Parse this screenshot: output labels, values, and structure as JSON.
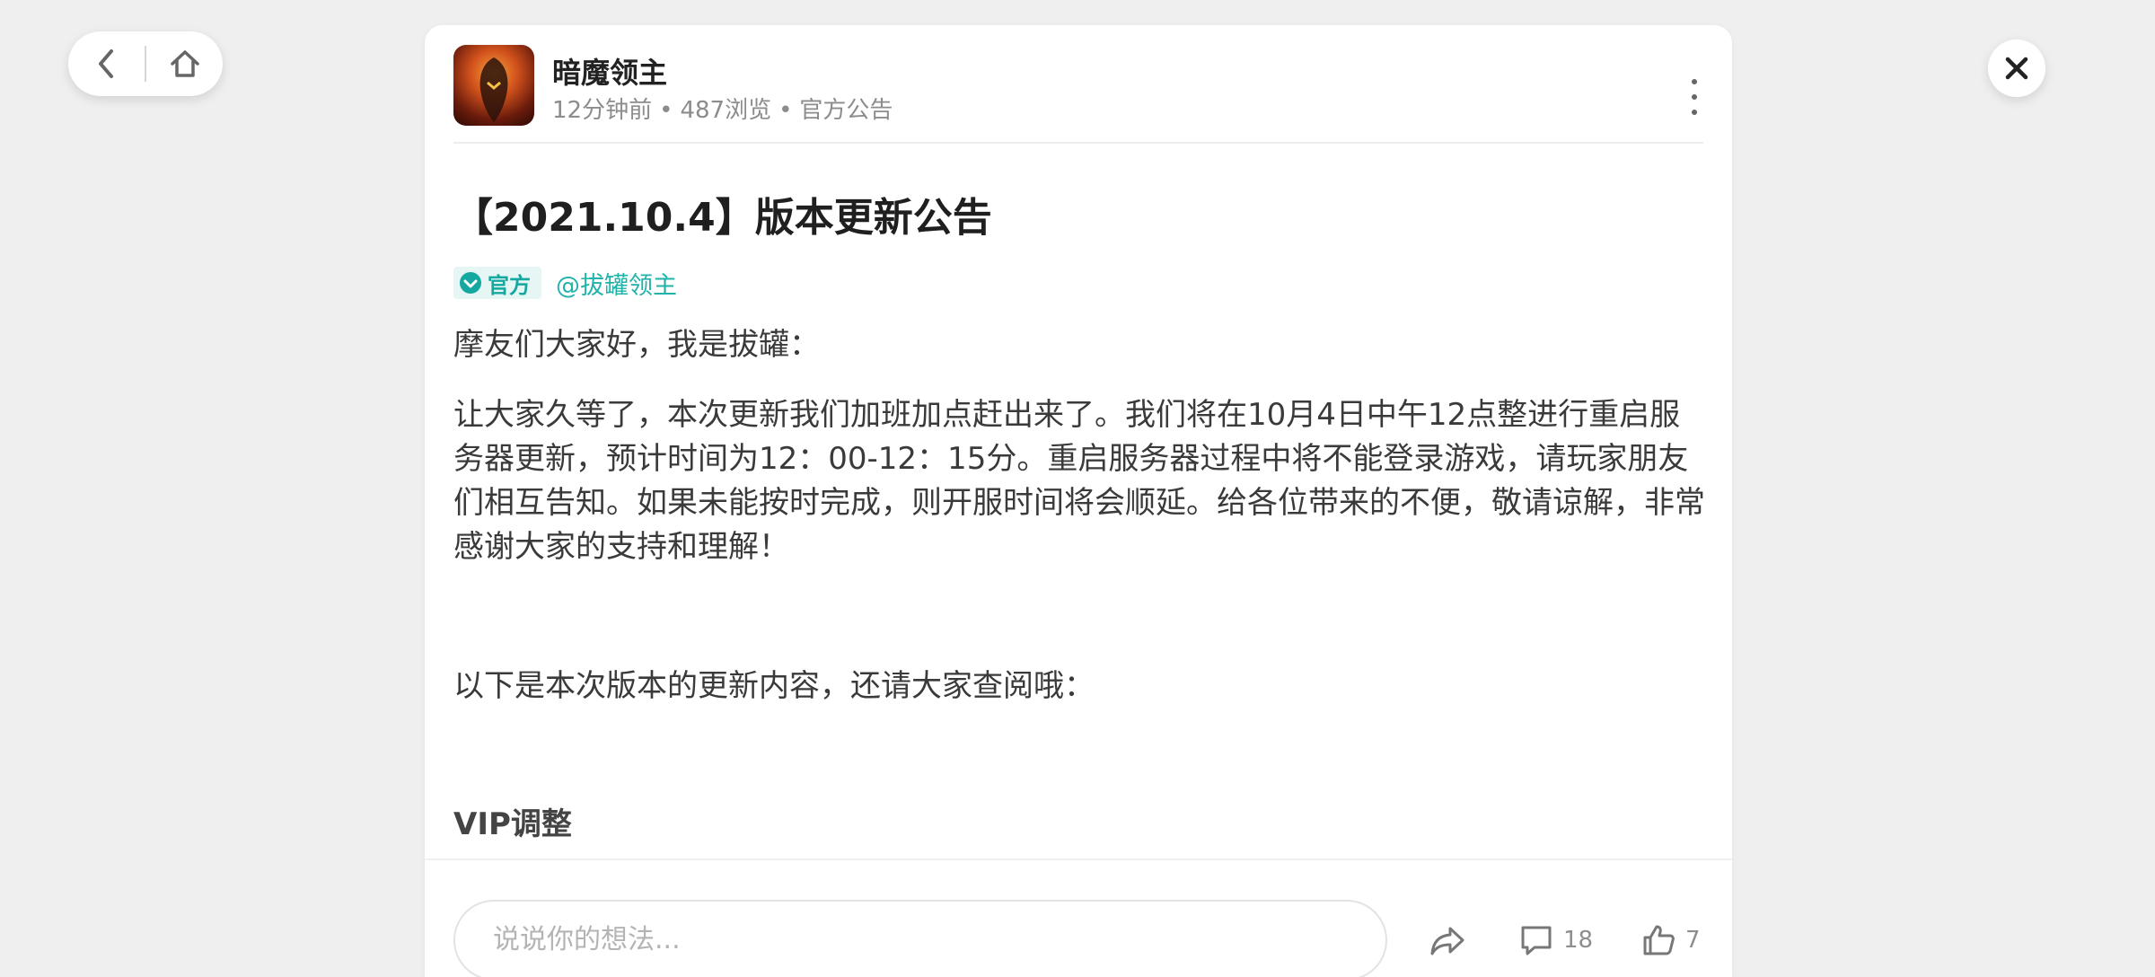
{
  "post": {
    "author": "暗魔领主",
    "meta_time": "12分钟前",
    "meta_views": "487浏览",
    "meta_category": "官方公告",
    "title": "【2021.10.4】版本更新公告",
    "official_tag": "官方",
    "mention": "@拔罐领主",
    "greeting": "摩友们大家好，我是拔罐：",
    "body": "让大家久等了，本次更新我们加班加点赶出来了。我们将在10月4日中午12点整进行重启服务器更新，预计时间为12：00-12：15分。重启服务器过程中将不能登录游戏，请玩家朋友们相互告知。如果未能按时完成，则开服时间将会顺延。给各位带来的不便，敬请谅解，非常感谢大家的支持和理解！",
    "intro": "以下是本次版本的更新内容，还请大家查阅哦：",
    "section_heading": "VIP调整"
  },
  "bottom": {
    "comment_placeholder": "说说你的想法...",
    "comment_count": "18",
    "like_count": "7"
  },
  "icons": {
    "back": "chevron-left-icon",
    "home": "home-icon",
    "close": "close-icon",
    "more": "more-vertical-icon",
    "share": "share-icon",
    "comment": "comment-icon",
    "like": "thumbs-up-icon"
  },
  "colors": {
    "accent": "#1fb3aa",
    "background": "#efefef"
  }
}
